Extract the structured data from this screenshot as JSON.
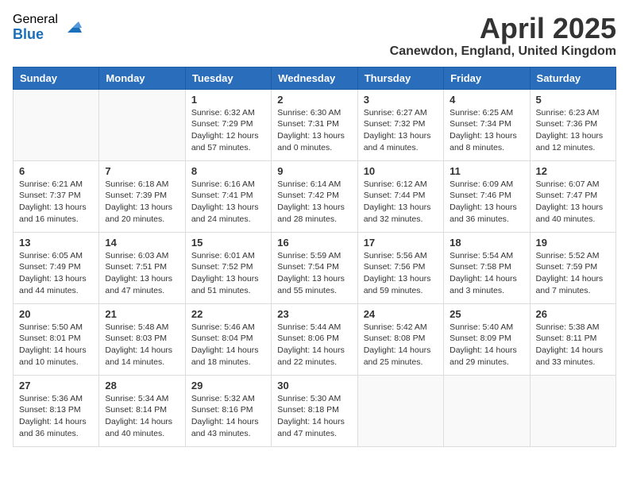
{
  "header": {
    "logo_general": "General",
    "logo_blue": "Blue",
    "month_title": "April 2025",
    "location": "Canewdon, England, United Kingdom"
  },
  "days_of_week": [
    "Sunday",
    "Monday",
    "Tuesday",
    "Wednesday",
    "Thursday",
    "Friday",
    "Saturday"
  ],
  "weeks": [
    [
      {
        "day": "",
        "info": ""
      },
      {
        "day": "",
        "info": ""
      },
      {
        "day": "1",
        "info": "Sunrise: 6:32 AM\nSunset: 7:29 PM\nDaylight: 12 hours\nand 57 minutes."
      },
      {
        "day": "2",
        "info": "Sunrise: 6:30 AM\nSunset: 7:31 PM\nDaylight: 13 hours\nand 0 minutes."
      },
      {
        "day": "3",
        "info": "Sunrise: 6:27 AM\nSunset: 7:32 PM\nDaylight: 13 hours\nand 4 minutes."
      },
      {
        "day": "4",
        "info": "Sunrise: 6:25 AM\nSunset: 7:34 PM\nDaylight: 13 hours\nand 8 minutes."
      },
      {
        "day": "5",
        "info": "Sunrise: 6:23 AM\nSunset: 7:36 PM\nDaylight: 13 hours\nand 12 minutes."
      }
    ],
    [
      {
        "day": "6",
        "info": "Sunrise: 6:21 AM\nSunset: 7:37 PM\nDaylight: 13 hours\nand 16 minutes."
      },
      {
        "day": "7",
        "info": "Sunrise: 6:18 AM\nSunset: 7:39 PM\nDaylight: 13 hours\nand 20 minutes."
      },
      {
        "day": "8",
        "info": "Sunrise: 6:16 AM\nSunset: 7:41 PM\nDaylight: 13 hours\nand 24 minutes."
      },
      {
        "day": "9",
        "info": "Sunrise: 6:14 AM\nSunset: 7:42 PM\nDaylight: 13 hours\nand 28 minutes."
      },
      {
        "day": "10",
        "info": "Sunrise: 6:12 AM\nSunset: 7:44 PM\nDaylight: 13 hours\nand 32 minutes."
      },
      {
        "day": "11",
        "info": "Sunrise: 6:09 AM\nSunset: 7:46 PM\nDaylight: 13 hours\nand 36 minutes."
      },
      {
        "day": "12",
        "info": "Sunrise: 6:07 AM\nSunset: 7:47 PM\nDaylight: 13 hours\nand 40 minutes."
      }
    ],
    [
      {
        "day": "13",
        "info": "Sunrise: 6:05 AM\nSunset: 7:49 PM\nDaylight: 13 hours\nand 44 minutes."
      },
      {
        "day": "14",
        "info": "Sunrise: 6:03 AM\nSunset: 7:51 PM\nDaylight: 13 hours\nand 47 minutes."
      },
      {
        "day": "15",
        "info": "Sunrise: 6:01 AM\nSunset: 7:52 PM\nDaylight: 13 hours\nand 51 minutes."
      },
      {
        "day": "16",
        "info": "Sunrise: 5:59 AM\nSunset: 7:54 PM\nDaylight: 13 hours\nand 55 minutes."
      },
      {
        "day": "17",
        "info": "Sunrise: 5:56 AM\nSunset: 7:56 PM\nDaylight: 13 hours\nand 59 minutes."
      },
      {
        "day": "18",
        "info": "Sunrise: 5:54 AM\nSunset: 7:58 PM\nDaylight: 14 hours\nand 3 minutes."
      },
      {
        "day": "19",
        "info": "Sunrise: 5:52 AM\nSunset: 7:59 PM\nDaylight: 14 hours\nand 7 minutes."
      }
    ],
    [
      {
        "day": "20",
        "info": "Sunrise: 5:50 AM\nSunset: 8:01 PM\nDaylight: 14 hours\nand 10 minutes."
      },
      {
        "day": "21",
        "info": "Sunrise: 5:48 AM\nSunset: 8:03 PM\nDaylight: 14 hours\nand 14 minutes."
      },
      {
        "day": "22",
        "info": "Sunrise: 5:46 AM\nSunset: 8:04 PM\nDaylight: 14 hours\nand 18 minutes."
      },
      {
        "day": "23",
        "info": "Sunrise: 5:44 AM\nSunset: 8:06 PM\nDaylight: 14 hours\nand 22 minutes."
      },
      {
        "day": "24",
        "info": "Sunrise: 5:42 AM\nSunset: 8:08 PM\nDaylight: 14 hours\nand 25 minutes."
      },
      {
        "day": "25",
        "info": "Sunrise: 5:40 AM\nSunset: 8:09 PM\nDaylight: 14 hours\nand 29 minutes."
      },
      {
        "day": "26",
        "info": "Sunrise: 5:38 AM\nSunset: 8:11 PM\nDaylight: 14 hours\nand 33 minutes."
      }
    ],
    [
      {
        "day": "27",
        "info": "Sunrise: 5:36 AM\nSunset: 8:13 PM\nDaylight: 14 hours\nand 36 minutes."
      },
      {
        "day": "28",
        "info": "Sunrise: 5:34 AM\nSunset: 8:14 PM\nDaylight: 14 hours\nand 40 minutes."
      },
      {
        "day": "29",
        "info": "Sunrise: 5:32 AM\nSunset: 8:16 PM\nDaylight: 14 hours\nand 43 minutes."
      },
      {
        "day": "30",
        "info": "Sunrise: 5:30 AM\nSunset: 8:18 PM\nDaylight: 14 hours\nand 47 minutes."
      },
      {
        "day": "",
        "info": ""
      },
      {
        "day": "",
        "info": ""
      },
      {
        "day": "",
        "info": ""
      }
    ]
  ]
}
